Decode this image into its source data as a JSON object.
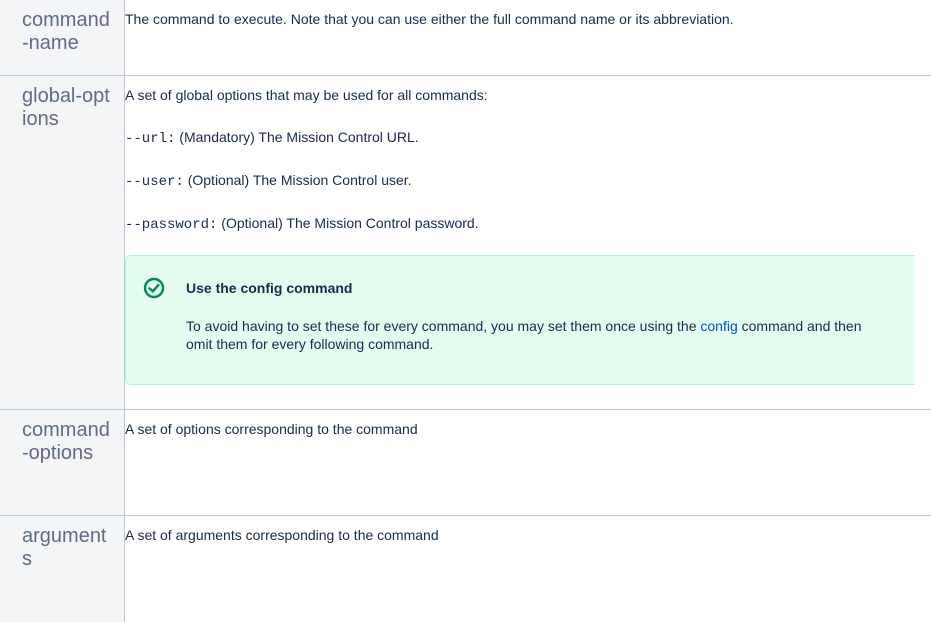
{
  "rows": [
    {
      "name": "command-name",
      "description": "The command to execute. Note that you can use either the full command name or its abbreviation."
    },
    {
      "name": "global-options",
      "intro": "A set of global options that may be used for all commands:",
      "options": [
        {
          "flag": "--url",
          "colon": ":",
          "text": " (Mandatory) The Mission Control URL."
        },
        {
          "flag": "--user",
          "colon": ":",
          "text": " (Optional) The Mission Control user."
        },
        {
          "flag": "--password",
          "colon": ":",
          "text": " (Optional) The Mission Control password."
        }
      ],
      "tip": {
        "icon": "check-circle-icon",
        "title": "Use the config command",
        "body_before": "To avoid having to set these for every command, you may set them once using the ",
        "link_text": "config",
        "body_after": " command and then omit them for every following command."
      }
    },
    {
      "name": "command-options",
      "description": "A set of options corresponding to the command"
    },
    {
      "name": "arguments",
      "description": "A set of arguments corresponding to the command"
    }
  ],
  "colors": {
    "tip_background": "#e3fcef",
    "tip_border": "#abf5d1",
    "tip_icon": "#00875a",
    "link": "#0052cc",
    "name_text": "#5e6c84"
  }
}
